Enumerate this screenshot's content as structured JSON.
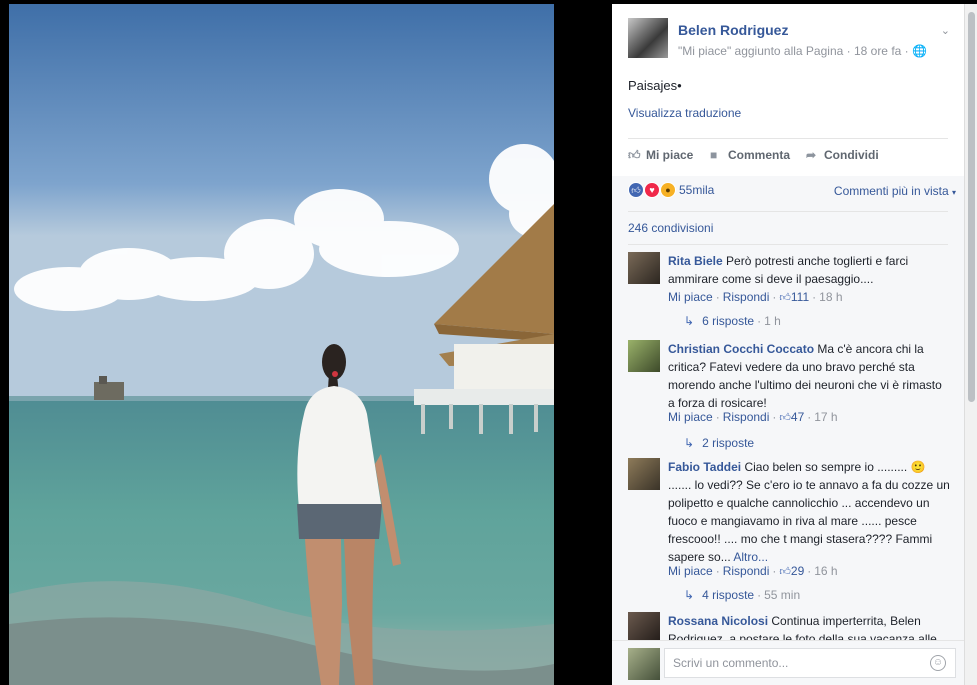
{
  "post": {
    "author": "Belen Rodriguez",
    "meta": "\"Mi piace\" aggiunto alla Pagina · 18 ore fa ·",
    "text": "Paisajes•",
    "translate_link": "Visualizza traduzione"
  },
  "actions": {
    "like": "Mi piace",
    "comment": "Commenta",
    "share": "Condividi"
  },
  "stats": {
    "reactions_count": "55mila",
    "sort_label": "Commenti più in vista",
    "shares": "246 condivisioni"
  },
  "comments": [
    {
      "name": "Rita Biele",
      "text": "Però potresti anche toglierti e farci ammirare come si deve il paesaggio....",
      "like_label": "Mi piace",
      "reply_label": "Rispondi",
      "likes": "111",
      "time": "18 h",
      "replies_label": "6 risposte",
      "replies_time": "1 h"
    },
    {
      "name": "Christian Cocchi Coccato",
      "text": "Ma c'è ancora chi la critica? Fatevi vedere da uno bravo perché sta morendo anche l'ultimo dei neuroni che vi è rimasto a forza di rosicare!",
      "like_label": "Mi piace",
      "reply_label": "Rispondi",
      "likes": "47",
      "time": "17 h",
      "replies_label": "2 risposte"
    },
    {
      "name": "Fabio Taddei",
      "text": "Ciao belen so sempre io ......... 🙂 ....... lo vedi?? Se c'ero io te annavo a fa du cozze un polipetto e qualche cannolicchio ... accendevo un fuoco e mangiavamo in riva al mare ...... pesce frescooo!! .... mo che t mangi stasera???? Fammi sapere so...",
      "more": "Altro...",
      "like_label": "Mi piace",
      "reply_label": "Rispondi",
      "likes": "29",
      "time": "16 h",
      "replies_label": "4 risposte",
      "replies_time": "55 min"
    },
    {
      "name": "Rossana Nicolosi",
      "text": "Continua imperterrita, Belen Rodriguez, a postare le foto della sua vacanza alle"
    }
  ],
  "compose": {
    "placeholder": "Scrivi un commento..."
  },
  "colors": {
    "link": "#365899",
    "meta": "#90949c",
    "like_blue": "#4267b2"
  }
}
